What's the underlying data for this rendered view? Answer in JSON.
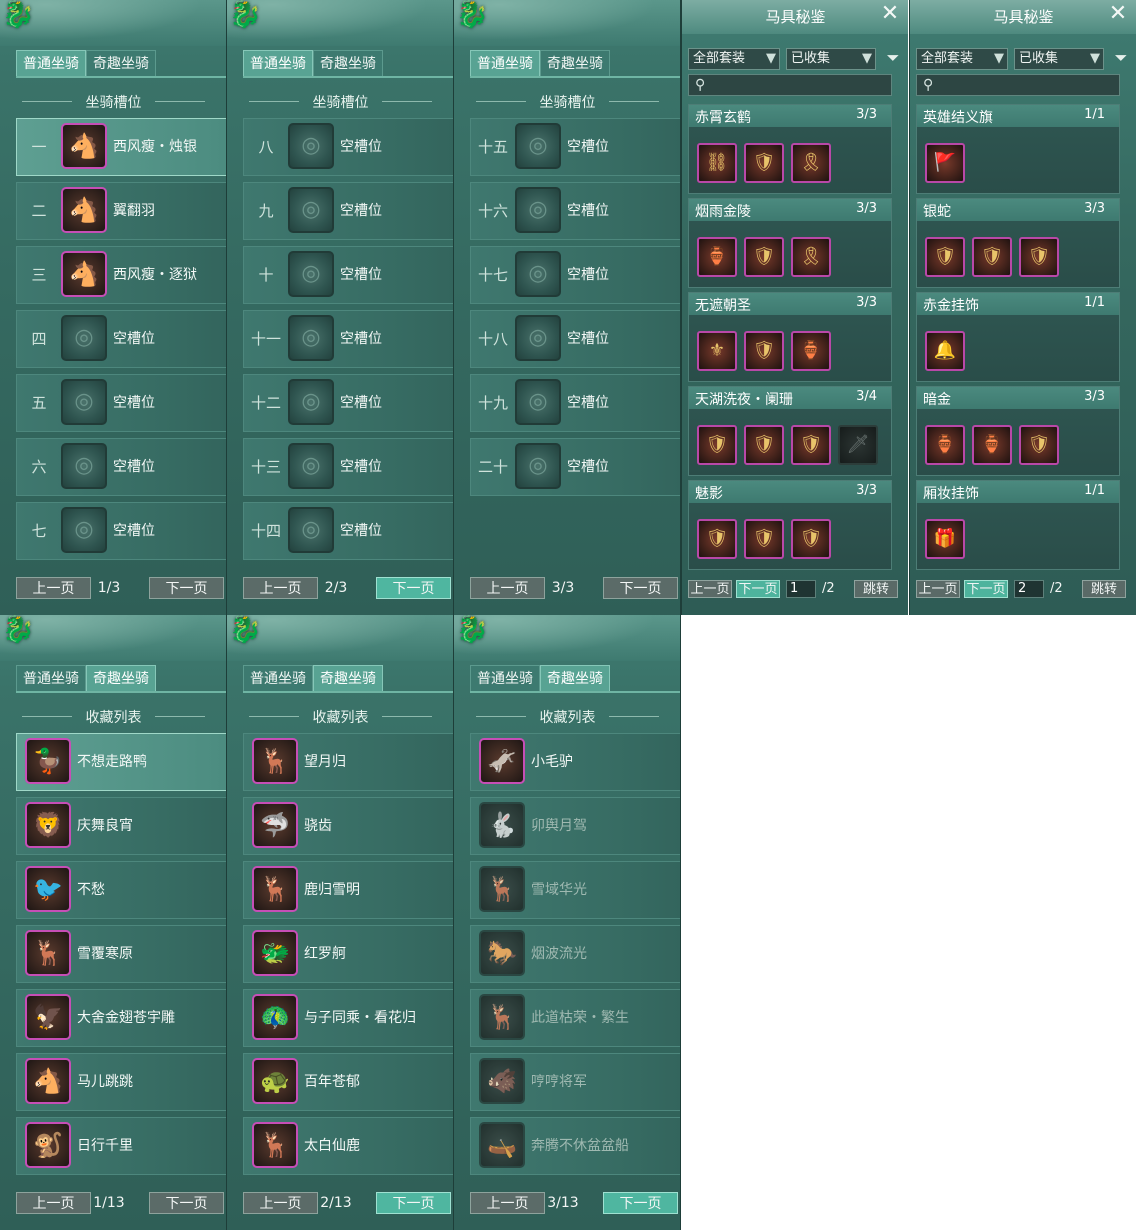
{
  "colors": {
    "accent": "#4fb6a0",
    "mount_border": "#c64eb6",
    "panel_bg": "#3a7369"
  },
  "tabs": {
    "normal": "普通坐骑",
    "fun": "奇趣坐骑"
  },
  "slot_title": "坐骑槽位",
  "collect_title": "收藏列表",
  "prev_label": "上一页",
  "next_label": "下一页",
  "empty_slot": "空槽位",
  "slot_pages": [
    {
      "page": "1/3",
      "slots": [
        {
          "num": "一",
          "name": "西风瘦・烛银",
          "mount": true,
          "icon": "horse-icon"
        },
        {
          "num": "二",
          "name": "翼翻羽",
          "mount": true,
          "icon": "horse-icon"
        },
        {
          "num": "三",
          "name": "西风瘦・逐狱",
          "mount": true,
          "icon": "horse-icon"
        },
        {
          "num": "四",
          "name": "空槽位",
          "mount": false,
          "icon": "empty-slot-icon"
        },
        {
          "num": "五",
          "name": "空槽位",
          "mount": false,
          "icon": "empty-slot-icon"
        },
        {
          "num": "六",
          "name": "空槽位",
          "mount": false,
          "icon": "empty-slot-icon"
        },
        {
          "num": "七",
          "name": "空槽位",
          "mount": false,
          "icon": "empty-slot-icon"
        }
      ]
    },
    {
      "page": "2/3",
      "slots": [
        {
          "num": "八",
          "name": "空槽位",
          "mount": false
        },
        {
          "num": "九",
          "name": "空槽位",
          "mount": false
        },
        {
          "num": "十",
          "name": "空槽位",
          "mount": false
        },
        {
          "num": "十一",
          "name": "空槽位",
          "mount": false
        },
        {
          "num": "十二",
          "name": "空槽位",
          "mount": false
        },
        {
          "num": "十三",
          "name": "空槽位",
          "mount": false
        },
        {
          "num": "十四",
          "name": "空槽位",
          "mount": false
        }
      ]
    },
    {
      "page": "3/3",
      "slots": [
        {
          "num": "十五",
          "name": "空槽位",
          "mount": false
        },
        {
          "num": "十六",
          "name": "空槽位",
          "mount": false
        },
        {
          "num": "十七",
          "name": "空槽位",
          "mount": false
        },
        {
          "num": "十八",
          "name": "空槽位",
          "mount": false
        },
        {
          "num": "十九",
          "name": "空槽位",
          "mount": false
        },
        {
          "num": "二十",
          "name": "空槽位",
          "mount": false
        }
      ]
    }
  ],
  "collect_pages": [
    {
      "page": "1/13",
      "items": [
        {
          "name": "不想走路鸭",
          "owned": true
        },
        {
          "name": "庆舞良宵",
          "owned": true
        },
        {
          "name": "不愁",
          "owned": true
        },
        {
          "name": "雪覆寒原",
          "owned": true
        },
        {
          "name": "大舍金翅苍宇雕",
          "owned": true
        },
        {
          "name": "马儿跳跳",
          "owned": true
        },
        {
          "name": "日行千里",
          "owned": true
        }
      ]
    },
    {
      "page": "2/13",
      "items": [
        {
          "name": "望月归",
          "owned": true
        },
        {
          "name": "骁齿",
          "owned": true
        },
        {
          "name": "鹿归雪明",
          "owned": true
        },
        {
          "name": "红罗舸",
          "owned": true
        },
        {
          "name": "与子同乘・看花归",
          "owned": true
        },
        {
          "name": "百年苍郁",
          "owned": true
        },
        {
          "name": "太白仙鹿",
          "owned": true
        }
      ]
    },
    {
      "page": "3/13",
      "items": [
        {
          "name": "小毛驴",
          "owned": true
        },
        {
          "name": "卯舆月驾",
          "owned": false
        },
        {
          "name": "雪域华光",
          "owned": false
        },
        {
          "name": "烟波流光",
          "owned": false
        },
        {
          "name": "此道枯荣・繁生",
          "owned": false
        },
        {
          "name": "哼哼将军",
          "owned": false
        },
        {
          "name": "奔腾不休盆盆船",
          "owned": false
        }
      ]
    }
  ],
  "codex": [
    {
      "title": "马具秘鉴",
      "filter_set": "全部套装",
      "filter_state": "已收集",
      "page_input": "1",
      "page_total": "/2",
      "jump": "跳转",
      "sets": [
        {
          "name": "赤霄玄鹤",
          "count": "3/3",
          "pieces": 3,
          "owned": 3
        },
        {
          "name": "烟雨金陵",
          "count": "3/3",
          "pieces": 3,
          "owned": 3
        },
        {
          "name": "无遮朝圣",
          "count": "3/3",
          "pieces": 3,
          "owned": 3
        },
        {
          "name": "天湖洗夜・阑珊",
          "count": "3/4",
          "pieces": 4,
          "owned": 3
        },
        {
          "name": "魅影",
          "count": "3/3",
          "pieces": 3,
          "owned": 3
        }
      ]
    },
    {
      "title": "马具秘鉴",
      "filter_set": "全部套装",
      "filter_state": "已收集",
      "page_input": "2",
      "page_total": "/2",
      "jump": "跳转",
      "sets": [
        {
          "name": "英雄结义旗",
          "count": "1/1",
          "pieces": 1,
          "owned": 1
        },
        {
          "name": "银蛇",
          "count": "3/3",
          "pieces": 3,
          "owned": 3
        },
        {
          "name": "赤金挂饰",
          "count": "1/1",
          "pieces": 1,
          "owned": 1
        },
        {
          "name": "暗金",
          "count": "3/3",
          "pieces": 3,
          "owned": 3
        },
        {
          "name": "厢妆挂饰",
          "count": "1/1",
          "pieces": 1,
          "owned": 1
        }
      ]
    }
  ]
}
